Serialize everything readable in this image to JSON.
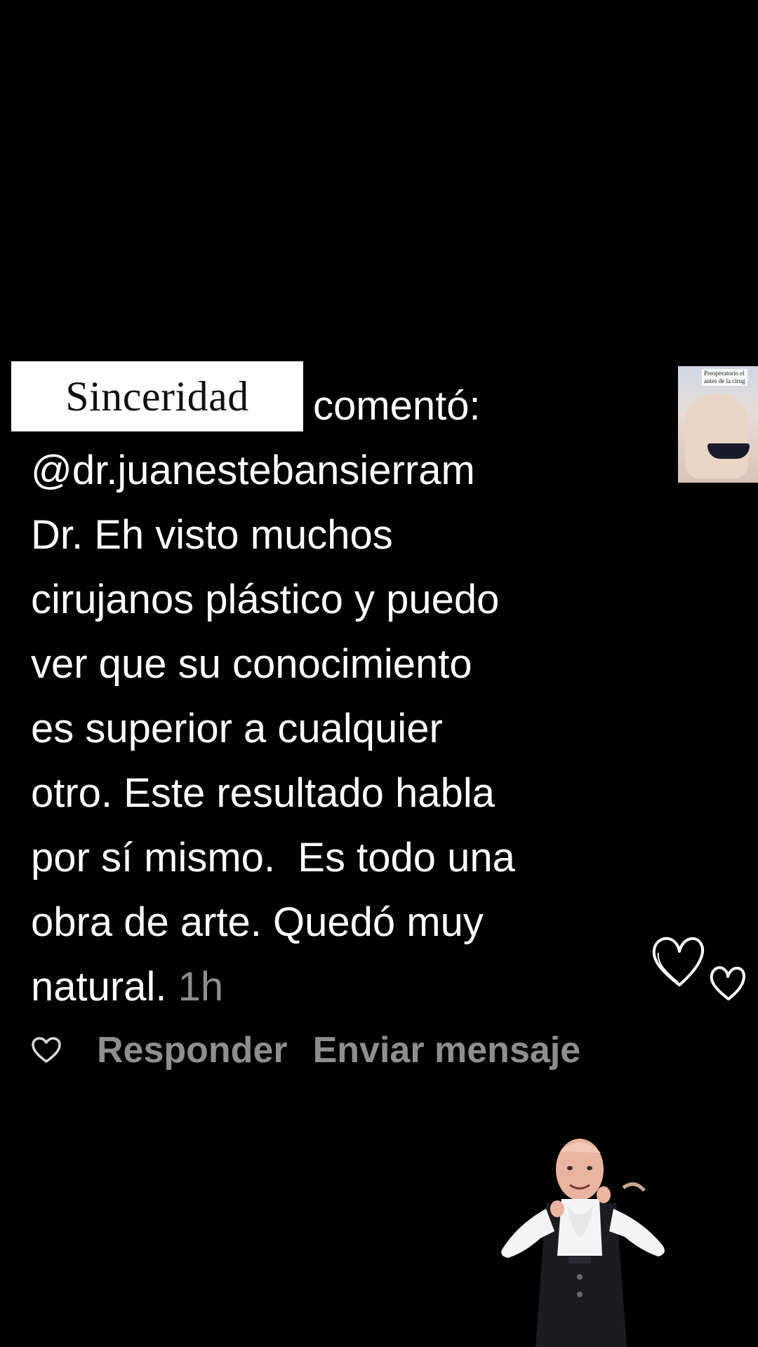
{
  "label": {
    "text": "Sinceridad"
  },
  "comment": {
    "verb": "comentó:",
    "mention": "@dr.juanestebansierram",
    "body": "Dr. Eh visto muchos cirujanos plástico y puedo ver que su conocimiento es superior a cualquier otro. Este resultado habla por sí mismo.  Es todo una obra de arte. Quedó muy natural.",
    "lines": [
      "Dr. Eh visto muchos",
      "cirujanos plástico y puedo",
      "ver que su conocimiento",
      "es superior a cualquier",
      "otro. Este resultado habla",
      "por sí mismo.  Es todo una",
      "obra de arte. Quedó muy",
      "natural."
    ],
    "time": "1h"
  },
  "actions": {
    "reply_label": "Responder",
    "message_label": "Enviar mensaje",
    "like_icon": "heart-outline-icon"
  },
  "thumbnail": {
    "caption_line1": "Preoperatorio el",
    "caption_line2": "antes de la cirug"
  },
  "decorations": {
    "hearts_icon": "doodle-hearts-icon",
    "sticker": "dancing-man-sticker"
  },
  "colors": {
    "background": "#000000",
    "text": "#ffffff",
    "muted": "#8e8e8e",
    "label_bg": "#ffffff"
  }
}
